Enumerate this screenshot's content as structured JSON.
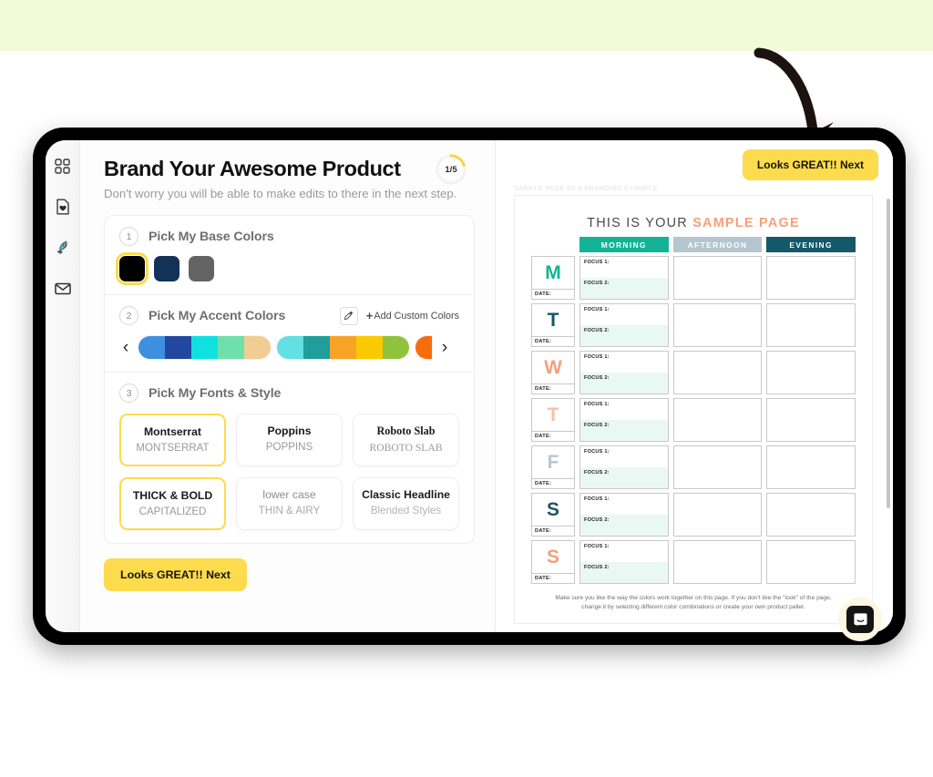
{
  "banner": {
    "present": true,
    "color": "#f1fbd6"
  },
  "annotation": {
    "arrow": "curved-down-arrow",
    "color": "#1c120f"
  },
  "sidebar": {
    "items": [
      {
        "name": "grid-icon",
        "label": "Dashboard"
      },
      {
        "name": "document-heart-icon",
        "label": "My Products"
      },
      {
        "name": "rocket-icon",
        "label": "Launch"
      },
      {
        "name": "envelope-icon",
        "label": "Messages"
      }
    ]
  },
  "editor": {
    "title": "Brand Your Awesome Product",
    "progress": "1/5",
    "progress_percent": 20,
    "subtitle": "Don't worry you will be able to make edits to there in the next step.",
    "next_label": "Looks GREAT!! Next",
    "steps": [
      {
        "number": "1",
        "label": "Pick My Base Colors",
        "swatches": [
          {
            "color": "#000000",
            "selected": true
          },
          {
            "color": "#123258",
            "selected": false
          },
          {
            "color": "#636363",
            "selected": false
          }
        ]
      },
      {
        "number": "2",
        "label": "Pick My Accent Colors",
        "eyedropper": "eyedropper-icon",
        "add_custom_label": "Add Custom Colors",
        "add_custom_plus": "+",
        "prev_arrow": "‹",
        "next_arrow": "›",
        "palettes": [
          {
            "colors": [
              "#3f8fe0",
              "#22479e",
              "#0fe2de",
              "#6fe0ab",
              "#f0cd92"
            ]
          },
          {
            "colors": [
              "#63e0e3",
              "#1f9e9b",
              "#f9a326",
              "#fbc900",
              "#90c33c"
            ]
          },
          {
            "colors": [
              "#f96c0b"
            ],
            "partial": true
          }
        ]
      },
      {
        "number": "3",
        "label": "Pick My Fonts & Style",
        "font_cards": [
          {
            "top": "Montserrat",
            "bottom": "MONTSERRAT",
            "selected": true,
            "style": "bold"
          },
          {
            "top": "Poppins",
            "bottom": "POPPINS",
            "selected": false,
            "style": "bold"
          },
          {
            "top": "Roboto Slab",
            "bottom": "ROBOTO SLAB",
            "selected": false,
            "style": "serif"
          }
        ],
        "style_cards": [
          {
            "top": "THICK & BOLD",
            "bottom": "CAPITALIZED",
            "selected": true,
            "style": "bold"
          },
          {
            "top": "lower case",
            "bottom": "THIN & AIRY",
            "selected": false,
            "style": "light"
          },
          {
            "top": "Classic Headline",
            "bottom": "Blended Styles",
            "selected": false,
            "style": "blend"
          }
        ]
      }
    ]
  },
  "preview": {
    "top_button": "Looks GREAT!! Next",
    "caption": "SAMPLE PAGE AS A BRANDING EXAMPLE",
    "sheet_title_plain": "THIS IS YOUR ",
    "sheet_title_accent": "SAMPLE PAGE",
    "accent_color": "#f6a07a",
    "columns": [
      {
        "label": "MORNING",
        "bg": "#12b495",
        "fg": "#ffffff"
      },
      {
        "label": "AFTERNOON",
        "bg": "#b4c6cf",
        "fg": "#ffffff"
      },
      {
        "label": "EVENING",
        "bg": "#13596b",
        "fg": "#ffffff"
      }
    ],
    "focus1_label": "FOCUS 1:",
    "focus2_label": "FOCUS 2:",
    "date_label": "DATE:",
    "days": [
      {
        "letter": "M",
        "color": "#12b495"
      },
      {
        "letter": "T",
        "color": "#13596b"
      },
      {
        "letter": "W",
        "color": "#f4a07c"
      },
      {
        "letter": "T",
        "color": "#f7bfa5"
      },
      {
        "letter": "F",
        "color": "#b4c9d4"
      },
      {
        "letter": "S",
        "color": "#1b5466"
      },
      {
        "letter": "S",
        "color": "#f4a07c"
      }
    ],
    "footer": "Make sure you like the way the colors work together on this page.  If you don't like the \"look\" of the page, change it by selecting different color combinations or create your own product pallet."
  },
  "chat": {
    "name": "intercom-chat-button",
    "color": "#141414",
    "halo": "#fdf6e0"
  }
}
